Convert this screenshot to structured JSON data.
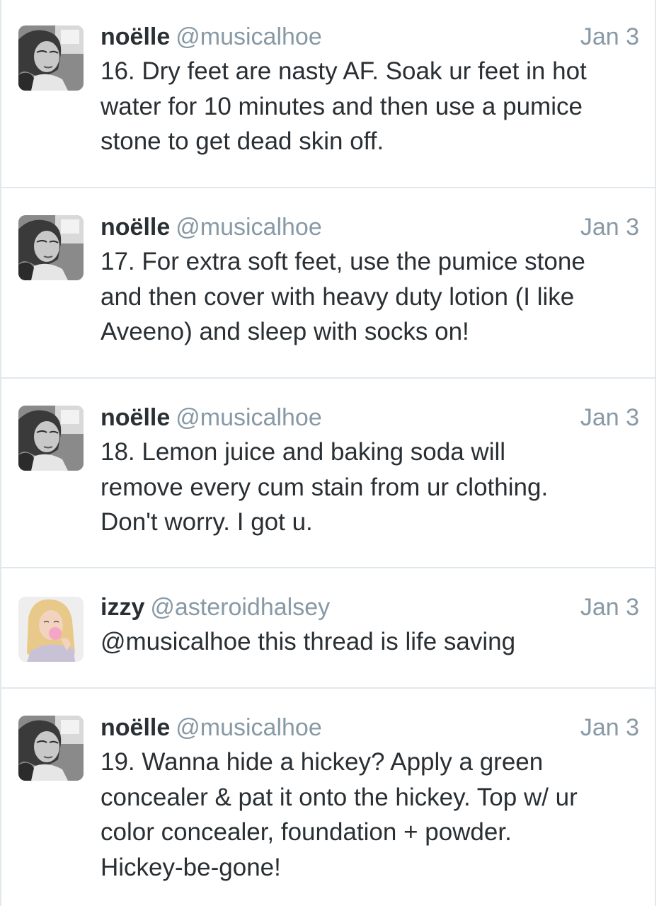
{
  "tweets": [
    {
      "name": "noëlle",
      "handle": "@musicalhoe",
      "time": "Jan 3",
      "text": "16. Dry feet are nasty AF. Soak ur feet in hot\nwater for 10 minutes and then use a pumice\nstone to get dead skin off.",
      "avatar": "bw-portrait"
    },
    {
      "name": "noëlle",
      "handle": "@musicalhoe",
      "time": "Jan 3",
      "text": "17. For extra soft feet, use the pumice stone\nand then cover with heavy duty lotion (I like\nAveeno) and sleep with socks on!",
      "avatar": "bw-portrait"
    },
    {
      "name": "noëlle",
      "handle": "@musicalhoe",
      "time": "Jan 3",
      "text": "18. Lemon juice and baking soda will\nremove every cum stain from ur clothing.\nDon't worry. I got u.",
      "avatar": "bw-portrait"
    },
    {
      "name": "izzy",
      "handle": "@asteroidhalsey",
      "time": "Jan 3",
      "text": "@musicalhoe this thread is life saving",
      "avatar": "blonde-bubblegum-portrait"
    },
    {
      "name": "noëlle",
      "handle": "@musicalhoe",
      "time": "Jan 3",
      "text": "19. Wanna hide a hickey? Apply a green\nconcealer & pat it onto the hickey. Top w/ ur\ncolor concealer, foundation + powder.\nHickey-be-gone!",
      "avatar": "bw-portrait"
    }
  ],
  "colors": {
    "name": "#292f33",
    "meta": "#8899a6",
    "divider": "#e1e8ed",
    "background": "#ffffff"
  }
}
